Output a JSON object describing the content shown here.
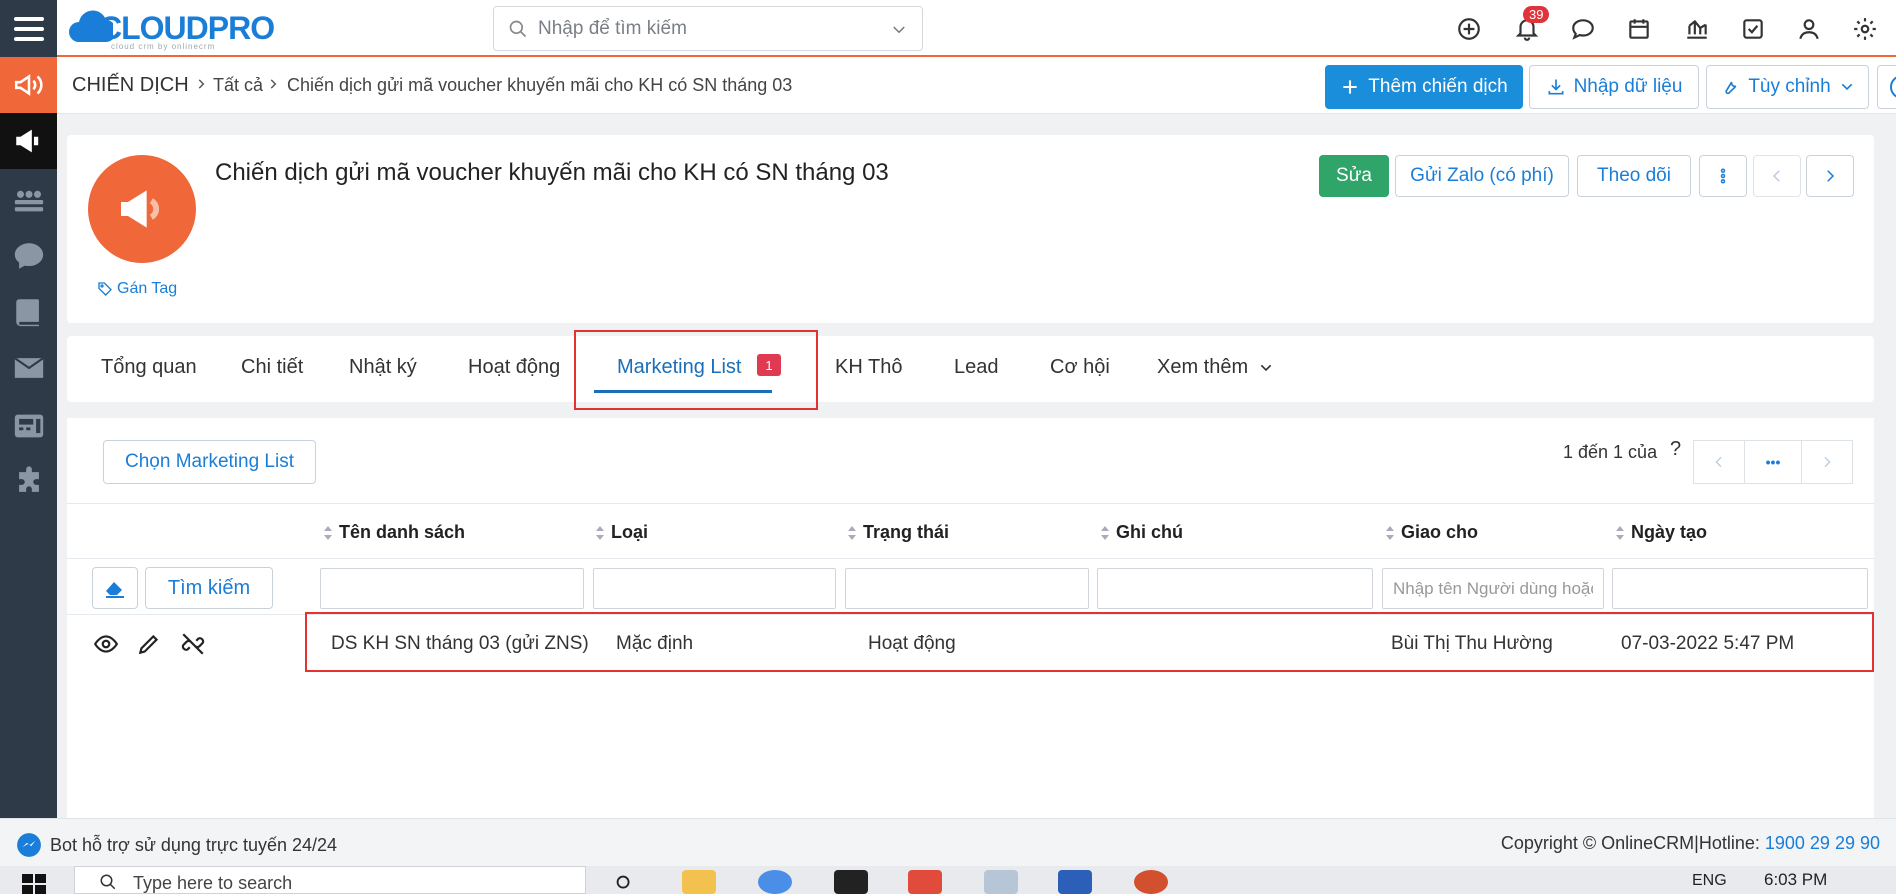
{
  "header": {
    "logo": "CLOUDPRO",
    "logo_sub": "cloud crm by onlinecrm",
    "search_placeholder": "Nhập để tìm kiếm",
    "notification_count": "39"
  },
  "breadcrumb": {
    "root": "CHIẾN DỊCH",
    "level1": "Tất cả",
    "current": "Chiến dịch gửi mã voucher khuyến mãi cho KH có SN tháng 03"
  },
  "actions": {
    "add": "Thêm chiến dịch",
    "import": "Nhập dữ liệu",
    "customize": "Tùy chỉnh",
    "help": "?"
  },
  "record": {
    "title": "Chiến dịch gửi mã voucher khuyến mãi cho KH có SN tháng 03",
    "tag_link": "Gán Tag",
    "edit": "Sửa",
    "send_zalo": "Gửi Zalo (có phí)",
    "follow": "Theo dõi"
  },
  "tabs": [
    {
      "label": "Tổng quan"
    },
    {
      "label": "Chi tiết"
    },
    {
      "label": "Nhật ký"
    },
    {
      "label": "Hoạt động"
    },
    {
      "label": "Marketing List",
      "badge": "1",
      "active": true
    },
    {
      "label": "KH Thô"
    },
    {
      "label": "Lead"
    },
    {
      "label": "Cơ hội"
    },
    {
      "label": "Xem thêm"
    }
  ],
  "list": {
    "select_button": "Chọn Marketing List",
    "pager_text": "1 đến 1 của",
    "pager_q": "?",
    "pager_more": "•••",
    "search_button": "Tìm kiếm",
    "assign_placeholder": "Nhập tên Người dùng hoặc Nhóm",
    "columns": [
      "Tên danh sách",
      "Loại",
      "Trạng thái",
      "Ghi chú",
      "Giao cho",
      "Ngày tạo"
    ],
    "rows": [
      {
        "name": "DS KH SN tháng 03 (gửi ZNS)",
        "type": "Mặc định",
        "status": "Hoạt động",
        "note": "",
        "assignee": "Bùi Thị Thu Hường",
        "created": "07-03-2022 5:47 PM"
      }
    ]
  },
  "footer": {
    "bot": "Bot hỗ trợ sử dụng trực tuyến 24/24",
    "copyright": "Copyright © OnlineCRM|Hotline: ",
    "hotline": "1900 29 29 90"
  },
  "taskbar": {
    "search_text": "Type here to search",
    "lang": "ENG",
    "time": "6:03 PM"
  },
  "colors": {
    "accent_orange": "#f0683a",
    "primary_blue": "#1a8ddb",
    "success_green": "#2fa56a",
    "sidebar": "#2e3a48",
    "highlight_red": "#e23232"
  }
}
